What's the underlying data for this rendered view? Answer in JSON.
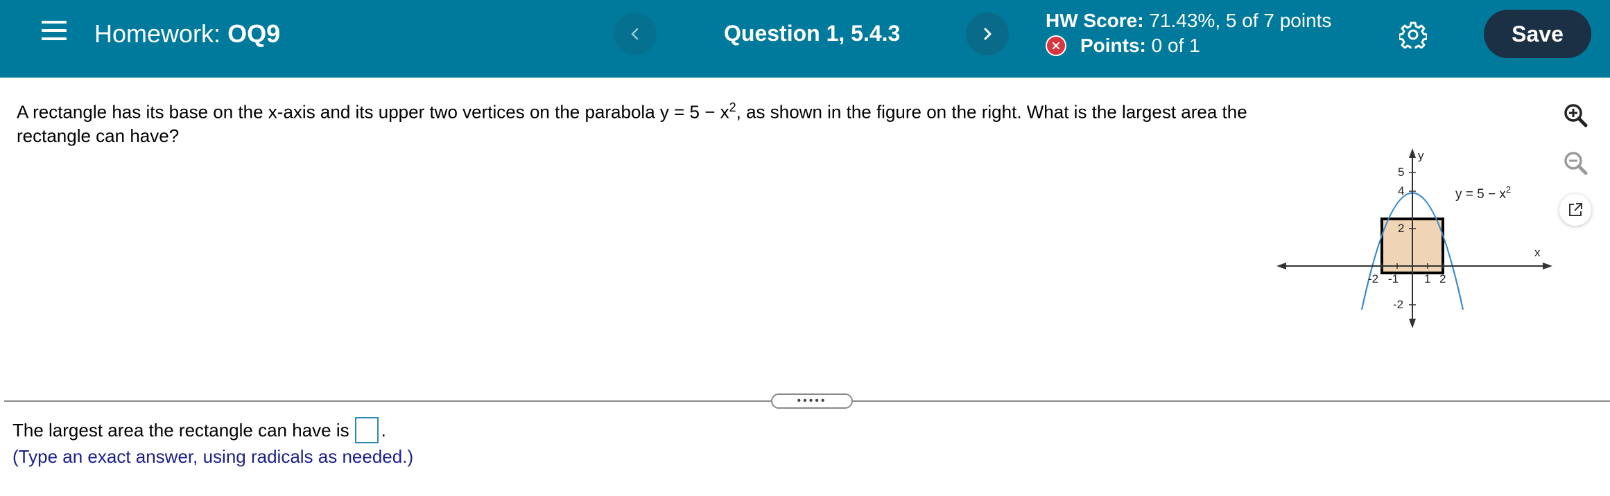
{
  "header": {
    "homework_prefix": "Homework:",
    "homework_name": "OQ9",
    "question_label": "Question 1, 5.4.3",
    "hw_score_label": "HW Score:",
    "hw_score_value": "71.43%, 5 of 7 points",
    "points_label": "Points:",
    "points_value": "0 of 1",
    "save_label": "Save",
    "prev_icon": "chevron-left-icon",
    "next_icon": "chevron-right-icon",
    "settings_icon": "gear-icon",
    "colors": {
      "header_bg": "#007a9c",
      "save_bg": "#1b2f45",
      "error": "#d8363f"
    }
  },
  "question": {
    "text_before": "A rectangle has its base on the x-axis and its upper two vertices on the parabola y = 5 − x",
    "exponent": "2",
    "text_after": ", as shown in the figure on the right. What is the largest area the rectangle can have?"
  },
  "figure": {
    "y_axis_label": "y",
    "x_axis_label": "x",
    "curve_label": "y = 5 − x",
    "curve_label_exp": "2",
    "x_ticks": [
      "-2",
      "-1",
      "1",
      "2"
    ],
    "y_ticks": [
      "5",
      "4",
      "2",
      "-2"
    ],
    "colors": {
      "curve": "#3a8ac8",
      "rectangle_fill": "#efd5b5"
    }
  },
  "tools": {
    "zoom_in_icon": "zoom-in-icon",
    "zoom_out_icon": "zoom-out-icon",
    "popout_icon": "popout-icon"
  },
  "answer": {
    "prompt": "The largest area the rectangle can have is",
    "suffix": ".",
    "input_value": "",
    "hint": "(Type an exact answer, using radicals as needed.)"
  }
}
